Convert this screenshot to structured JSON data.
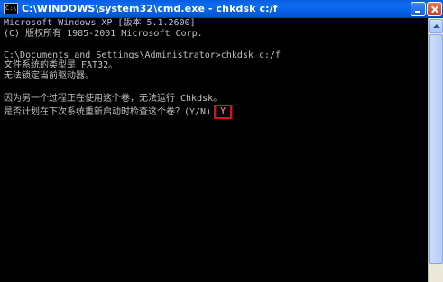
{
  "window": {
    "title": "C:\\WINDOWS\\system32\\cmd.exe - chkdsk c:/f",
    "icon_name": "cmd-icon",
    "icon_glyph": "C:\\",
    "colors": {
      "titlebar": "#0b6df3",
      "console_bg": "#000000",
      "console_text": "#c0c0c0",
      "highlight_box": "#e01010"
    }
  },
  "console": {
    "lines": [
      "Microsoft Windows XP [版本 5.1.2600]",
      "(C) 版权所有 1985-2001 Microsoft Corp.",
      "C:\\Documents and Settings\\Administrator>chkdsk c:/f",
      "文件系统的类型是 FAT32。",
      "无法锁定当前驱动器。",
      "因为另一个过程正在使用这个卷，无法运行 Chkdsk。",
      "是否计划在下次系统重新启动时检查这个卷？(Y/N)"
    ],
    "answer": "Y"
  }
}
